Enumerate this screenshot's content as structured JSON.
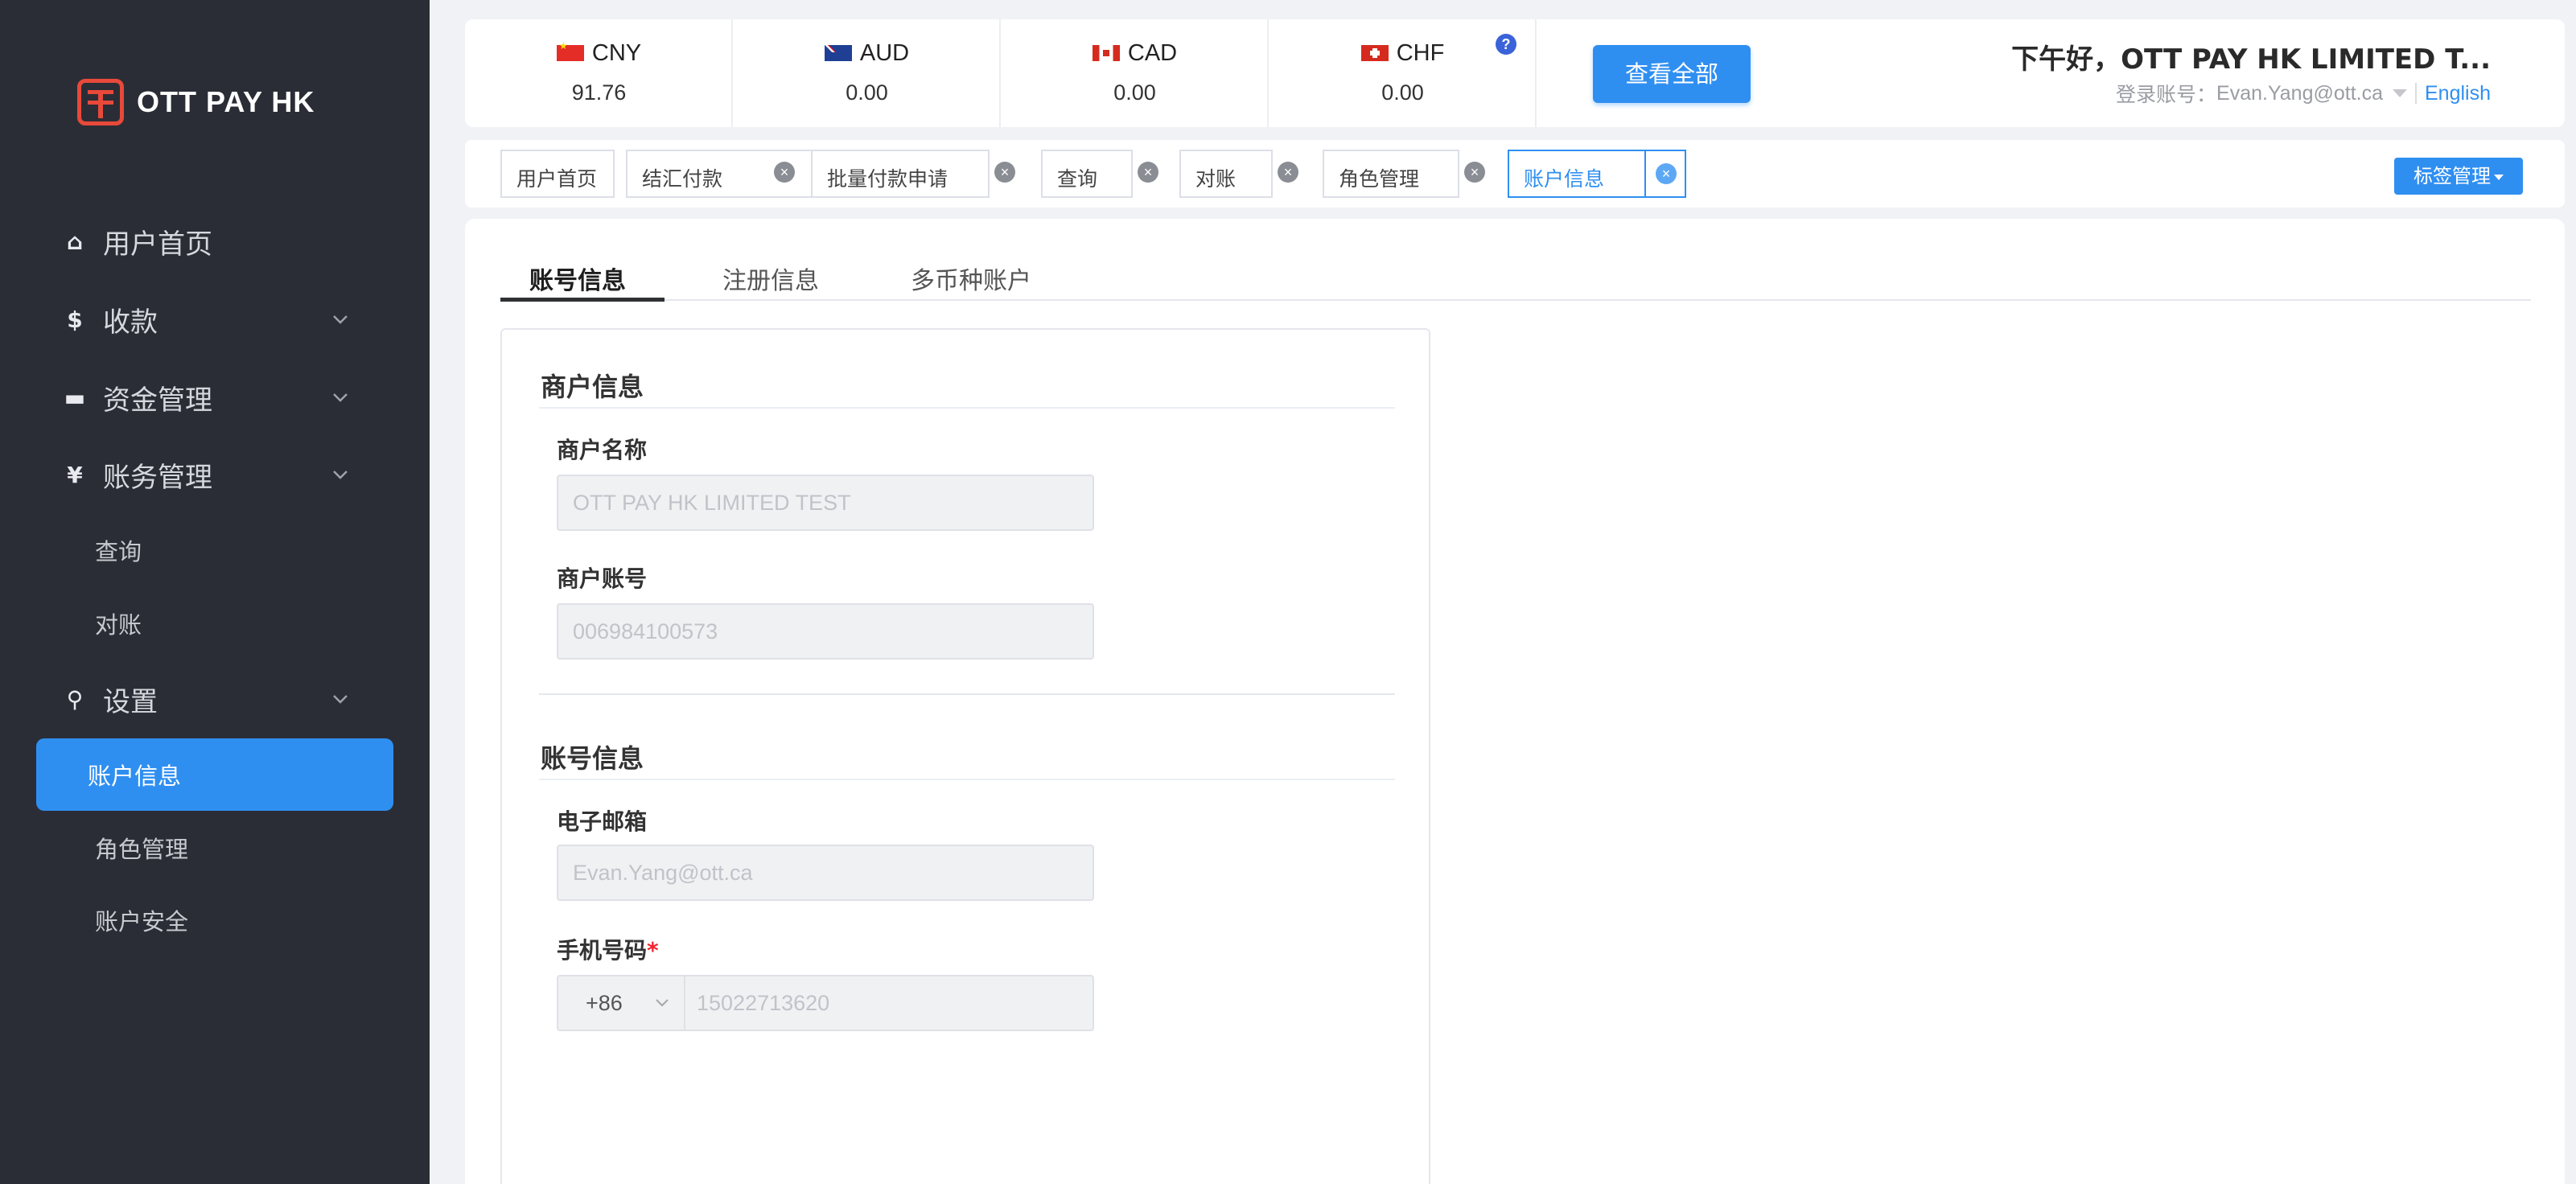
{
  "brand": {
    "logo_text": "OTT PAY HK",
    "accent_color": "#2f8ff1",
    "sidebar_bg": "#2b2d36",
    "logo_color": "#e8493a"
  },
  "sidebar": {
    "items": [
      {
        "icon": "home-icon",
        "glyph": "⌂",
        "label": "用户首页"
      },
      {
        "icon": "dollar-icon",
        "glyph": "$",
        "label": "收款"
      },
      {
        "icon": "card-icon",
        "glyph": "▬",
        "label": "资金管理"
      },
      {
        "icon": "yen-icon",
        "glyph": "¥",
        "label": "账务管理"
      },
      {
        "label": "查询"
      },
      {
        "label": "对账"
      },
      {
        "icon": "search-icon",
        "glyph": "⚲",
        "label": "设置"
      },
      {
        "label": "账户信息",
        "active": true
      },
      {
        "label": "角色管理"
      },
      {
        "label": "账户安全"
      }
    ]
  },
  "balances": [
    {
      "code": "CNY",
      "value": "91.76",
      "flag": "cn-flag-icon"
    },
    {
      "code": "AUD",
      "value": "0.00",
      "flag": "au-flag-icon"
    },
    {
      "code": "CAD",
      "value": "0.00",
      "flag": "ca-flag-icon"
    },
    {
      "code": "CHF",
      "value": "0.00",
      "flag": "ch-flag-icon"
    }
  ],
  "header": {
    "help_glyph": "?",
    "view_all_label": "查看全部",
    "greeting": "下午好，OTT PAY HK LIMITED T...",
    "account_prefix": "登录账号：",
    "account_email": "Evan.Yang@ott.ca",
    "language": "English"
  },
  "tabs": [
    {
      "label": "用户首页",
      "closable": false
    },
    {
      "label": "结汇付款",
      "closable": true
    },
    {
      "label": "批量付款申请",
      "closable": true
    },
    {
      "label": "查询",
      "closable": true
    },
    {
      "label": "对账",
      "closable": true
    },
    {
      "label": "角色管理",
      "closable": true
    },
    {
      "label": "账户信息",
      "closable": true,
      "active": true
    }
  ],
  "tab_close_glyph": "×",
  "tag_management_label": "标签管理",
  "content_tabs": [
    {
      "label": "账号信息",
      "active": true
    },
    {
      "label": "注册信息"
    },
    {
      "label": "多币种账户"
    }
  ],
  "merchant_section": {
    "title": "商户信息",
    "name_label": "商户名称",
    "name_value": "OTT PAY HK LIMITED TEST",
    "account_label": "商户账号",
    "account_value": "006984100573"
  },
  "account_section": {
    "title": "账号信息",
    "email_label": "电子邮箱",
    "email_value": "Evan.Yang@ott.ca",
    "phone_label": "手机号码",
    "required_mark": "*",
    "phone_code": "+86",
    "phone_value": "15022713620"
  }
}
